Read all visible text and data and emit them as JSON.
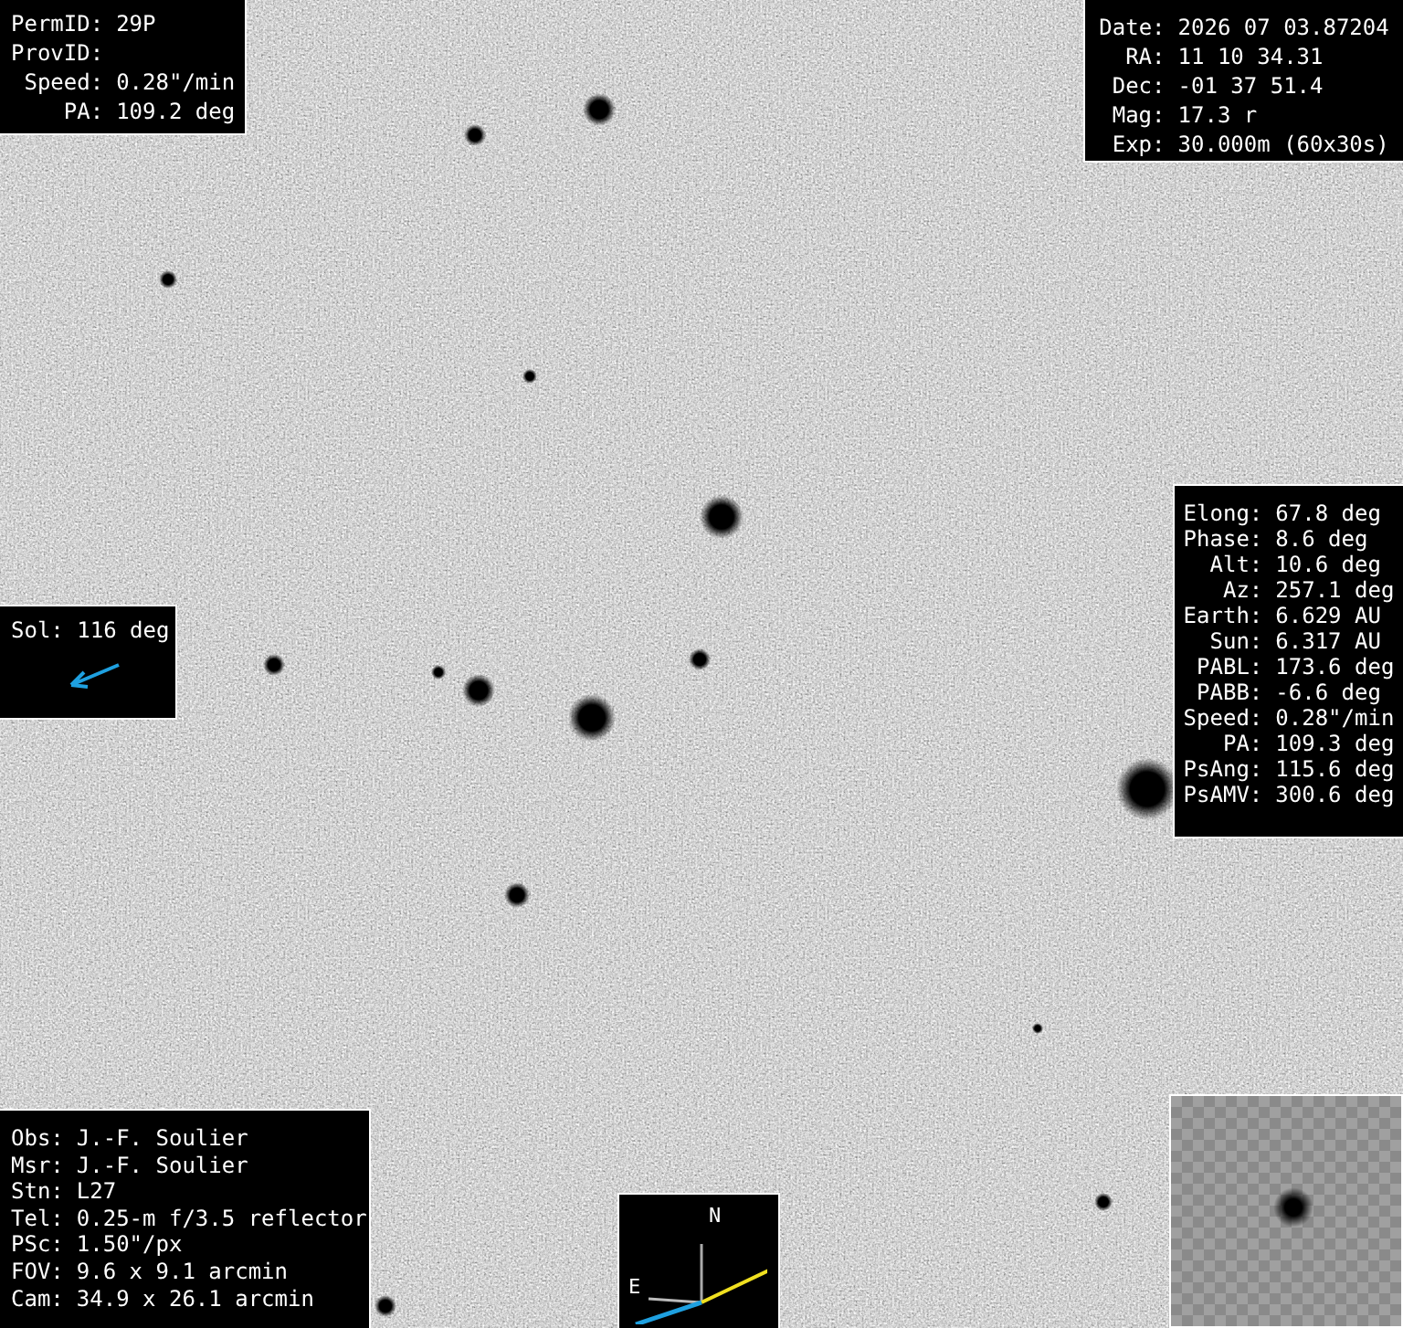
{
  "object_panel": [
    {
      "label": "PermID:",
      "value": "29P"
    },
    {
      "label": "ProvID:"
    },
    {
      "label": "Speed:",
      "value": "0.28\"/min"
    },
    {
      "label": "PA:",
      "value": "109.2 deg"
    }
  ],
  "position_panel": [
    {
      "label": "Date:",
      "value": "2026 07 03.87204"
    },
    {
      "label": "RA:",
      "value": "11 10 34.31"
    },
    {
      "label": "Dec:",
      "value": "-01 37 51.4"
    },
    {
      "label": "Mag:",
      "value": "17.3 r"
    },
    {
      "label": "Exp:",
      "value": "30.000m (60x30s)"
    }
  ],
  "geometry_panel": [
    {
      "label": "Elong:",
      "value": "67.8 deg"
    },
    {
      "label": "Phase:",
      "value": "8.6 deg"
    },
    {
      "label": "Alt:",
      "value": "10.6 deg"
    },
    {
      "label": "Az:",
      "value": "257.1 deg"
    },
    {
      "label": "Earth:",
      "value": "6.629 AU"
    },
    {
      "label": "Sun:",
      "value": "6.317 AU"
    },
    {
      "label": "PABL:",
      "value": "173.6 deg"
    },
    {
      "label": "PABB:",
      "value": "-6.6 deg"
    },
    {
      "label": "Speed:",
      "value": "0.28\"/min"
    },
    {
      "label": "PA:",
      "value": "109.3 deg"
    },
    {
      "label": "PsAng:",
      "value": "115.6 deg"
    },
    {
      "label": "PsAMV:",
      "value": "300.6 deg"
    }
  ],
  "sun_panel": {
    "text": "Sol: 116 deg"
  },
  "observer_panel": [
    {
      "label": "Obs:",
      "value": "J.-F. Soulier"
    },
    {
      "label": "Msr:",
      "value": "J.-F. Soulier"
    },
    {
      "label": "Stn:",
      "value": "L27"
    },
    {
      "label": "Tel:",
      "value": "0.25-m f/3.5 reflector"
    },
    {
      "label": "PSc:",
      "value": "1.50\"/px"
    },
    {
      "label": "FOV:",
      "value": "9.6 x 9.1 arcmin"
    },
    {
      "label": "Cam:",
      "value": "34.9 x 26.1 arcmin"
    }
  ],
  "compass": {
    "north": "N",
    "east": "E"
  }
}
